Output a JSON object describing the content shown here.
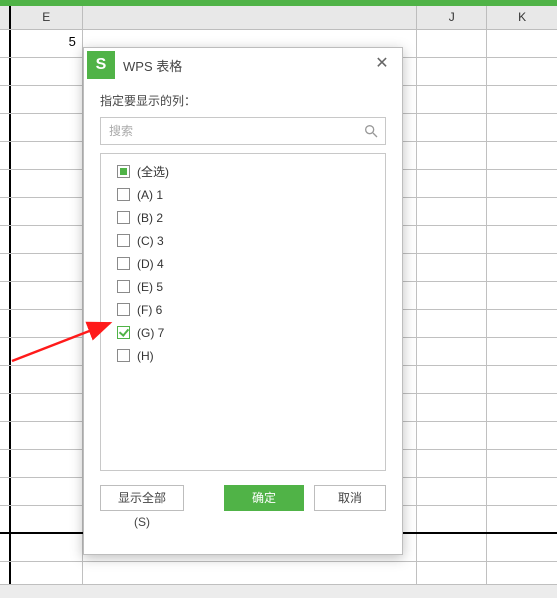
{
  "spreadsheet": {
    "columns": [
      "E",
      "J",
      "K"
    ],
    "cell_e1": "5"
  },
  "dialog": {
    "app_icon_letter": "S",
    "title": "WPS 表格",
    "close_glyph": "✕",
    "label": "指定要显示的列：",
    "search_placeholder": "搜索",
    "items": [
      {
        "label": "(全选)",
        "state": "indeterminate"
      },
      {
        "label": "(A) 1",
        "state": "unchecked"
      },
      {
        "label": "(B) 2",
        "state": "unchecked"
      },
      {
        "label": "(C) 3",
        "state": "unchecked"
      },
      {
        "label": "(D) 4",
        "state": "unchecked"
      },
      {
        "label": "(E) 5",
        "state": "unchecked"
      },
      {
        "label": "(F) 6",
        "state": "unchecked"
      },
      {
        "label": "(G) 7",
        "state": "checked"
      },
      {
        "label": "(H)",
        "state": "unchecked"
      }
    ],
    "buttons": {
      "show_all": "显示全部(S)",
      "ok": "确定",
      "cancel": "取消"
    }
  }
}
